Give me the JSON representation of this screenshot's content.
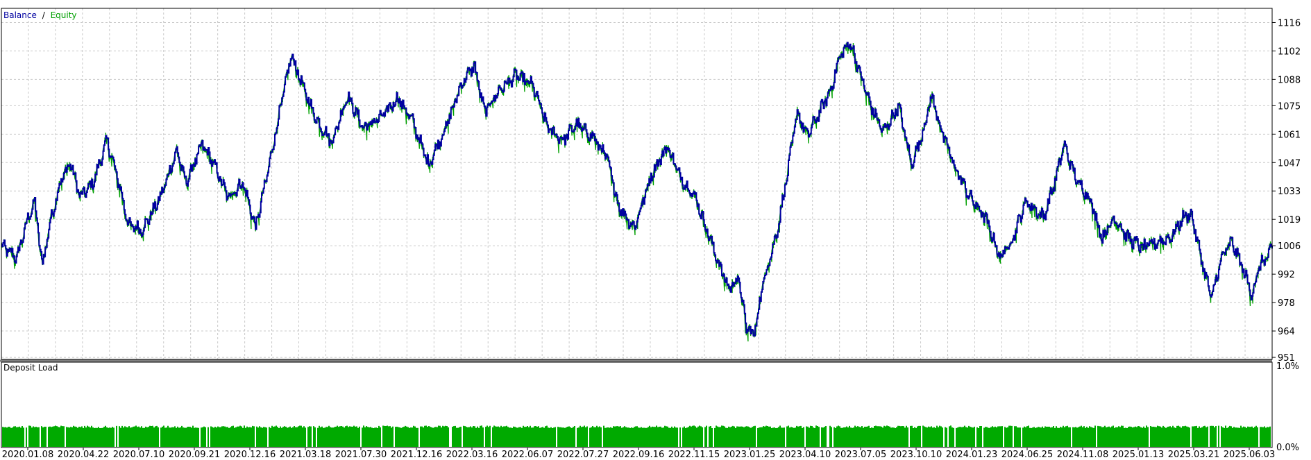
{
  "colors": {
    "balance": "#0000a0",
    "equity": "#00a000",
    "deposit_load": "#00aa00",
    "grid": "#c8c8c8",
    "frame": "#000000"
  },
  "legend": {
    "balance": "Balance",
    "separator": "/",
    "equity": "Equity"
  },
  "bottom_panel": {
    "title": "Deposit Load"
  },
  "chart_data": [
    {
      "type": "line",
      "series": [
        {
          "name": "Balance"
        },
        {
          "name": "Equity"
        }
      ],
      "x_tick_labels": [
        "2020.01.08",
        "2020.04.22",
        "2020.07.10",
        "2020.09.21",
        "2020.12.16",
        "2021.03.18",
        "2021.07.30",
        "2021.12.16",
        "2022.03.16",
        "2022.06.07",
        "2022.07.27",
        "2022.09.16",
        "2022.11.15",
        "2023.01.25",
        "2023.04.10",
        "2023.07.05",
        "2023.10.10",
        "2024.01.23",
        "2024.06.25",
        "2024.11.08",
        "2025.01.13",
        "2025.03.21",
        "2025.06.03"
      ],
      "y_tick_labels": [
        "1116",
        "1102",
        "1088",
        "1075",
        "1061",
        "1047",
        "1033",
        "1019",
        "1006",
        "992",
        "978",
        "964",
        "951"
      ],
      "y_ticks": [
        1116,
        1102,
        1088,
        1075,
        1061,
        1047,
        1033,
        1019,
        1006,
        992,
        978,
        964,
        951
      ],
      "ylim": [
        950,
        1123
      ],
      "grid": true,
      "keypoints": [
        [
          0,
          1006
        ],
        [
          0.012,
          1000
        ],
        [
          0.02,
          1018
        ],
        [
          0.026,
          1028
        ],
        [
          0.032,
          996
        ],
        [
          0.038,
          1017
        ],
        [
          0.046,
          1037
        ],
        [
          0.054,
          1047
        ],
        [
          0.062,
          1030
        ],
        [
          0.072,
          1037
        ],
        [
          0.083,
          1058
        ],
        [
          0.093,
          1035
        ],
        [
          0.1,
          1016
        ],
        [
          0.111,
          1014
        ],
        [
          0.125,
          1030
        ],
        [
          0.138,
          1053
        ],
        [
          0.145,
          1037
        ],
        [
          0.158,
          1056
        ],
        [
          0.168,
          1045
        ],
        [
          0.178,
          1030
        ],
        [
          0.19,
          1037
        ],
        [
          0.2,
          1015
        ],
        [
          0.21,
          1044
        ],
        [
          0.215,
          1060
        ],
        [
          0.228,
          1100
        ],
        [
          0.238,
          1083
        ],
        [
          0.248,
          1068
        ],
        [
          0.26,
          1057
        ],
        [
          0.272,
          1080
        ],
        [
          0.285,
          1064
        ],
        [
          0.3,
          1070
        ],
        [
          0.312,
          1079
        ],
        [
          0.323,
          1068
        ],
        [
          0.336,
          1046
        ],
        [
          0.35,
          1065
        ],
        [
          0.362,
          1086
        ],
        [
          0.372,
          1095
        ],
        [
          0.38,
          1072
        ],
        [
          0.392,
          1083
        ],
        [
          0.405,
          1090
        ],
        [
          0.418,
          1085
        ],
        [
          0.43,
          1064
        ],
        [
          0.442,
          1058
        ],
        [
          0.452,
          1066
        ],
        [
          0.465,
          1060
        ],
        [
          0.476,
          1050
        ],
        [
          0.486,
          1025
        ],
        [
          0.498,
          1015
        ],
        [
          0.512,
          1042
        ],
        [
          0.524,
          1055
        ],
        [
          0.534,
          1040
        ],
        [
          0.546,
          1030
        ],
        [
          0.556,
          1012
        ],
        [
          0.564,
          998
        ],
        [
          0.572,
          985
        ],
        [
          0.58,
          990
        ],
        [
          0.586,
          966
        ],
        [
          0.592,
          962
        ],
        [
          0.6,
          990
        ],
        [
          0.61,
          1012
        ],
        [
          0.618,
          1040
        ],
        [
          0.626,
          1072
        ],
        [
          0.634,
          1060
        ],
        [
          0.642,
          1070
        ],
        [
          0.652,
          1082
        ],
        [
          0.66,
          1100
        ],
        [
          0.668,
          1106
        ],
        [
          0.676,
          1090
        ],
        [
          0.684,
          1075
        ],
        [
          0.694,
          1062
        ],
        [
          0.706,
          1075
        ],
        [
          0.716,
          1046
        ],
        [
          0.724,
          1060
        ],
        [
          0.732,
          1080
        ],
        [
          0.74,
          1062
        ],
        [
          0.75,
          1045
        ],
        [
          0.762,
          1030
        ],
        [
          0.774,
          1020
        ],
        [
          0.786,
          1000
        ],
        [
          0.796,
          1010
        ],
        [
          0.806,
          1028
        ],
        [
          0.82,
          1020
        ],
        [
          0.83,
          1040
        ],
        [
          0.836,
          1056
        ],
        [
          0.846,
          1038
        ],
        [
          0.856,
          1030
        ],
        [
          0.866,
          1010
        ],
        [
          0.876,
          1020
        ],
        [
          0.886,
          1010
        ],
        [
          0.898,
          1005
        ],
        [
          0.91,
          1008
        ],
        [
          0.92,
          1010
        ],
        [
          0.93,
          1020
        ],
        [
          0.936,
          1022
        ],
        [
          0.944,
          1000
        ],
        [
          0.952,
          980
        ],
        [
          0.96,
          1000
        ],
        [
          0.968,
          1008
        ],
        [
          0.976,
          996
        ],
        [
          0.984,
          982
        ],
        [
          0.99,
          996
        ],
        [
          1,
          1004
        ]
      ]
    },
    {
      "type": "bar",
      "title": "Deposit Load",
      "y_tick_labels": [
        "1.0%",
        "0.0%"
      ],
      "ylim": [
        0,
        1.0
      ],
      "typical_value": 0.1
    }
  ]
}
